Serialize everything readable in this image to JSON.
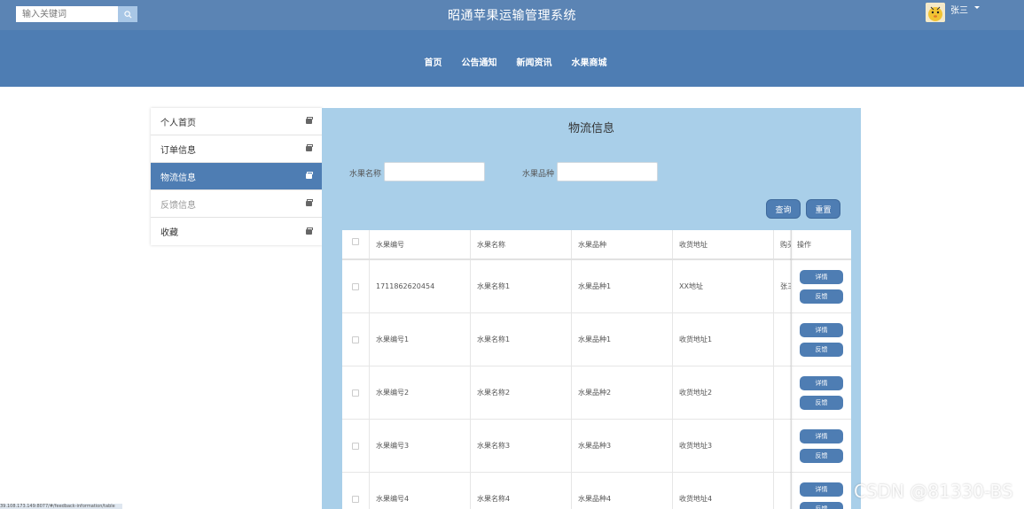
{
  "header": {
    "search_placeholder": "输入关键词",
    "site_title": "昭通苹果运输管理系统",
    "username": "张三"
  },
  "nav": {
    "items": [
      "首页",
      "公告通知",
      "新闻资讯",
      "水果商城"
    ]
  },
  "sidebar": {
    "items": [
      {
        "label": "个人首页"
      },
      {
        "label": "订单信息"
      },
      {
        "label": "物流信息"
      },
      {
        "label": "反馈信息"
      },
      {
        "label": "收藏"
      }
    ]
  },
  "main": {
    "title": "物流信息",
    "filters": {
      "fruit_name_label": "水果名称",
      "fruit_variety_label": "水果品种"
    },
    "query_label": "查询",
    "reset_label": "重置",
    "table": {
      "headers": [
        "水果编号",
        "水果名称",
        "水果品种",
        "收货地址",
        "购买",
        "操作"
      ],
      "rows": [
        {
          "id": "1711862620454",
          "name": "水果名称1",
          "variety": "水果品种1",
          "address": "XX地址",
          "buyer": "张三"
        },
        {
          "id": "水果编号1",
          "name": "水果名称1",
          "variety": "水果品种1",
          "address": "收货地址1",
          "buyer": ""
        },
        {
          "id": "水果编号2",
          "name": "水果名称2",
          "variety": "水果品种2",
          "address": "收货地址2",
          "buyer": ""
        },
        {
          "id": "水果编号3",
          "name": "水果名称3",
          "variety": "水果品种3",
          "address": "收货地址3",
          "buyer": ""
        },
        {
          "id": "水果编号4",
          "name": "水果名称4",
          "variety": "水果品种4",
          "address": "收货地址4",
          "buyer": ""
        }
      ],
      "detail_label": "详情",
      "feedback_label": "反馈"
    }
  },
  "watermark": "CSDN @81330-BS",
  "status_url": "39.108.173.149:8077/#/feedback-information/table",
  "colors": {
    "topbar": "#5b84b4",
    "navband": "#4e7db3",
    "content_bg": "#a9cfe9",
    "accent": "#4e7db3"
  }
}
